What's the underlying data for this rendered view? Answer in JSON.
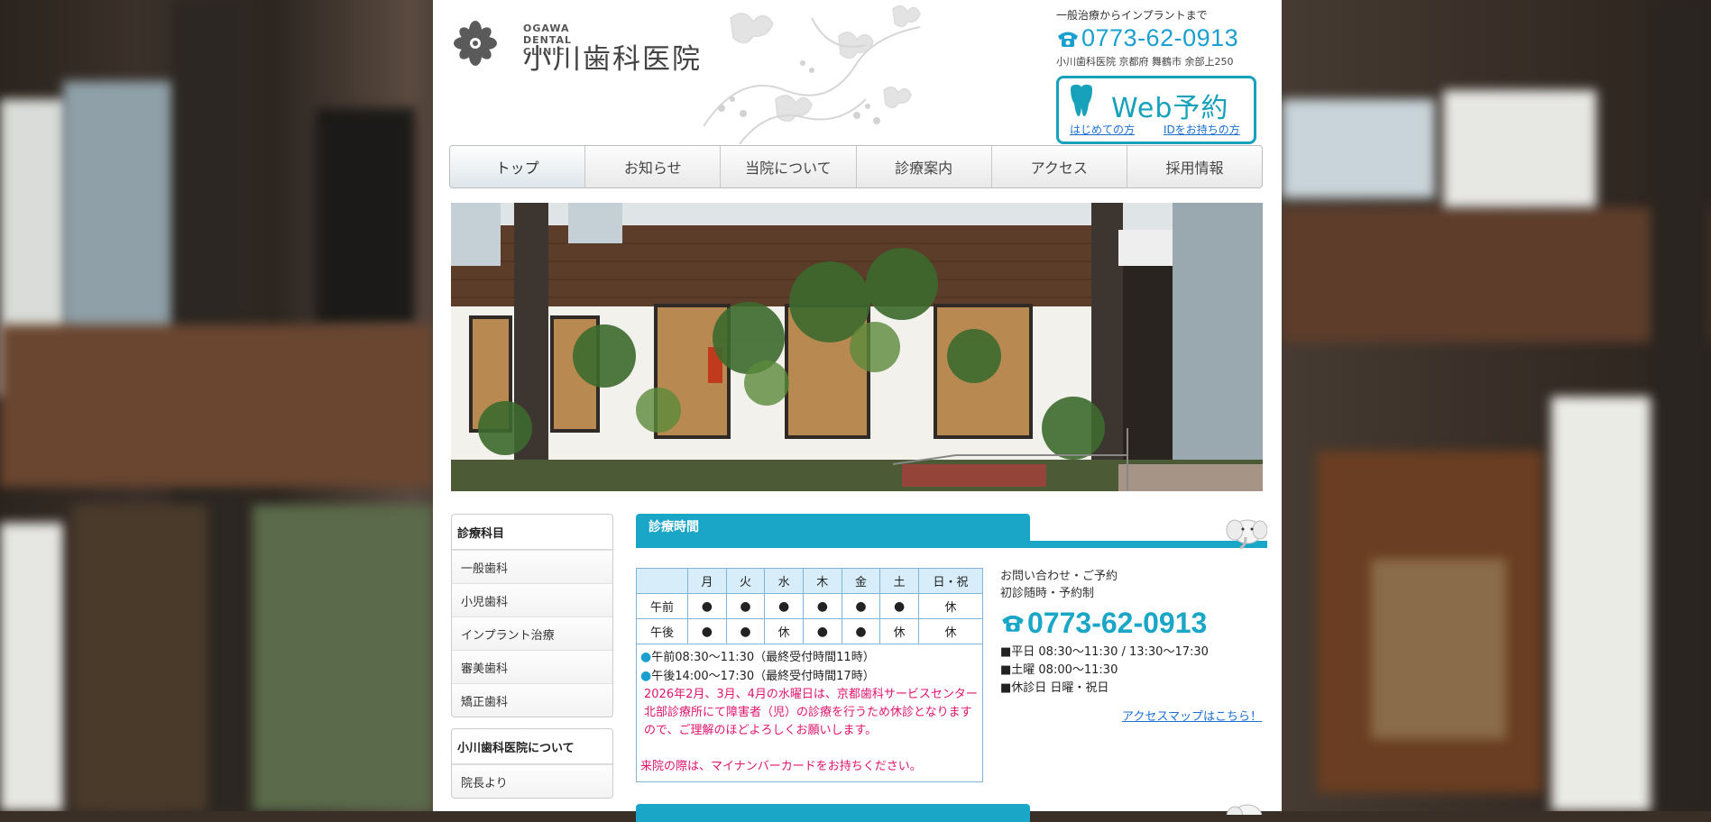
{
  "header": {
    "logo_sub": "OGAWA DENTAL CLINIC",
    "logo_title": "小川歯科医院",
    "caption": "一般治療からインプラントまで",
    "phone": "0773-62-0913",
    "address": "小川歯科医院 京都府 舞鶴市 余部上250",
    "web_title": "Web予約",
    "web_first": "はじめての方",
    "web_id": "IDをお持ちの方"
  },
  "nav": {
    "items": [
      "トップ",
      "お知らせ",
      "当院について",
      "診療案内",
      "アクセス",
      "採用情報"
    ],
    "active": 0
  },
  "sidebar": {
    "sections": [
      {
        "title": "診療科目",
        "items": [
          "一般歯科",
          "小児歯科",
          "インプラント治療",
          "審美歯科",
          "矯正歯科"
        ]
      },
      {
        "title": "小川歯科医院について",
        "items": [
          "院長より"
        ]
      }
    ]
  },
  "hours": {
    "title": "診療時間",
    "days": [
      "月",
      "火",
      "水",
      "木",
      "金",
      "土",
      "日・祝"
    ],
    "rows": [
      {
        "label": "午前",
        "cells": [
          "●",
          "●",
          "●",
          "●",
          "●",
          "●",
          "休"
        ]
      },
      {
        "label": "午後",
        "cells": [
          "●",
          "●",
          "休",
          "●",
          "●",
          "休",
          "休"
        ]
      }
    ],
    "note_am": "午前08:30～11:30（最終受付時間11時）",
    "note_pm": "午後14:00～17:30（最終受付時間17時）",
    "notice": "2026年2月、3月、4月の水曜日は、京都歯科サービスセンター北部診療所にて障害者（児）の診療を行うため休診となりますので、ご理解のほどよろしくお願いします。",
    "notice2": "来院の際は、マイナンバーカードをお持ちください。"
  },
  "contact": {
    "line1": "お問い合わせ・ご予約",
    "line2": "初診随時・予約制",
    "phone": "0773-62-0913",
    "weekday": "■平日 08:30～11:30 / 13:30～17:30",
    "saturday": "■土曜 08:00～11:30",
    "closed": "■休診日 日曜・祝日",
    "map_link": "アクセスマップはこちら！"
  },
  "colors": {
    "accent": "#1aa6c7",
    "phone": "#1a9fd0",
    "notice": "#e0136e",
    "link": "#1b6fd1"
  }
}
